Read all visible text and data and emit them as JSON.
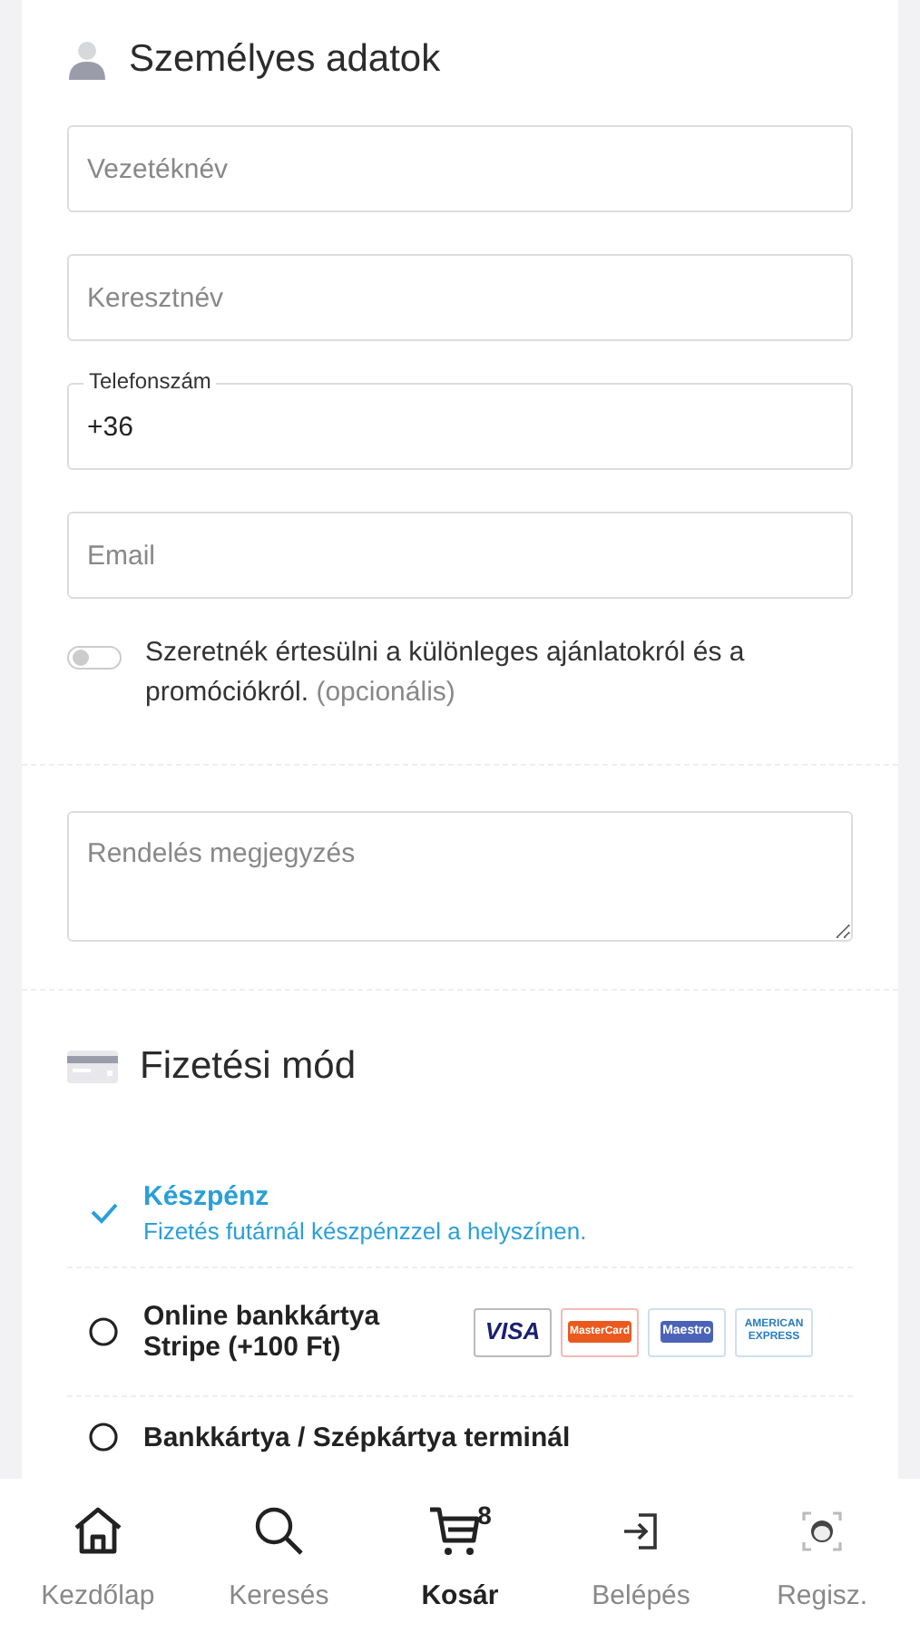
{
  "personal": {
    "title": "Személyes adatok"
  },
  "fields": [
    {
      "kind": "plain",
      "placeholder": "Vezetéknév"
    },
    {
      "kind": "plain",
      "placeholder": "Keresztnév"
    },
    {
      "kind": "labelled",
      "label": "Telefonszám",
      "value": "+36"
    },
    {
      "kind": "plain",
      "placeholder": "Email"
    }
  ],
  "newsletter": {
    "on": false,
    "text": "Szeretnék értesülni a különleges ajánlatokról és a promóciókról.",
    "optional": "(opcionális)"
  },
  "note": {
    "placeholder": "Rendelés megjegyzés"
  },
  "payment": {
    "title": "Fizetési mód"
  },
  "payment_options": [
    {
      "title": "Készpénz",
      "description": "Fizetés futárnál készpénzzel a helyszínen.",
      "selected": true
    },
    {
      "title": "Online bankkártya Stripe (+100 Ft)",
      "selected": false,
      "cards": [
        "VISA",
        "MasterCard",
        "Maestro",
        "AMERICAN EXPRESS"
      ]
    },
    {
      "title": "Bankkártya / Szépkártya terminál",
      "selected": false
    }
  ],
  "nav": [
    {
      "kind": "home",
      "label": "Kezdőlap",
      "selected": false
    },
    {
      "kind": "search",
      "label": "Keresés",
      "selected": false
    },
    {
      "kind": "cart",
      "label": "Kosár",
      "selected": true,
      "badge": "8"
    },
    {
      "kind": "login",
      "label": "Belépés",
      "selected": false
    },
    {
      "kind": "register",
      "label": "Regisz.",
      "selected": false
    }
  ]
}
